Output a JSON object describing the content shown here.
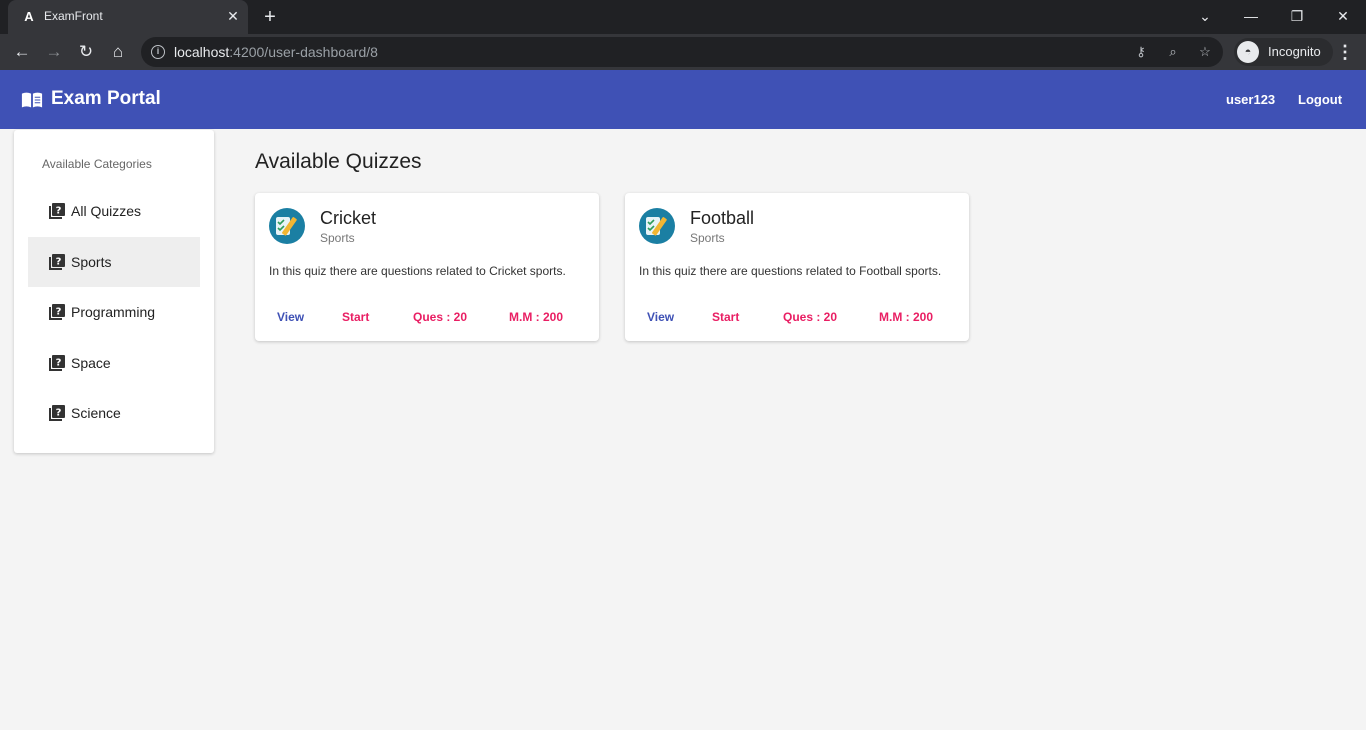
{
  "browser": {
    "tab_title": "ExamFront",
    "tab_favicon": "A",
    "url_host": "localhost",
    "url_path": ":4200/user-dashboard/8",
    "incognito_label": "Incognito"
  },
  "navbar": {
    "brand": "Exam Portal",
    "username": "user123",
    "logout": "Logout",
    "color": "#3f51b5"
  },
  "sidebar": {
    "header": "Available Categories",
    "items": [
      {
        "label": "All Quizzes",
        "icon": "quiz-icon"
      },
      {
        "label": "Sports",
        "icon": "quiz-icon",
        "active": true
      },
      {
        "label": "Programming",
        "icon": "quiz-icon"
      },
      {
        "label": "Space",
        "icon": "quiz-icon"
      },
      {
        "label": "Science",
        "icon": "quiz-icon"
      }
    ]
  },
  "main": {
    "title": "Available Quizzes",
    "quizzes": [
      {
        "title": "Cricket",
        "category": "Sports",
        "description": "In this quiz there are questions related to Cricket sports.",
        "view": "View",
        "start": "Start",
        "questions": "Ques : 20",
        "max_marks": "M.M : 200"
      },
      {
        "title": "Football",
        "category": "Sports",
        "description": "In this quiz there are questions related to Football sports.",
        "view": "View",
        "start": "Start",
        "questions": "Ques : 20",
        "max_marks": "M.M : 200"
      }
    ]
  },
  "colors": {
    "primary": "#3f51b5",
    "accent": "#e91e63"
  }
}
